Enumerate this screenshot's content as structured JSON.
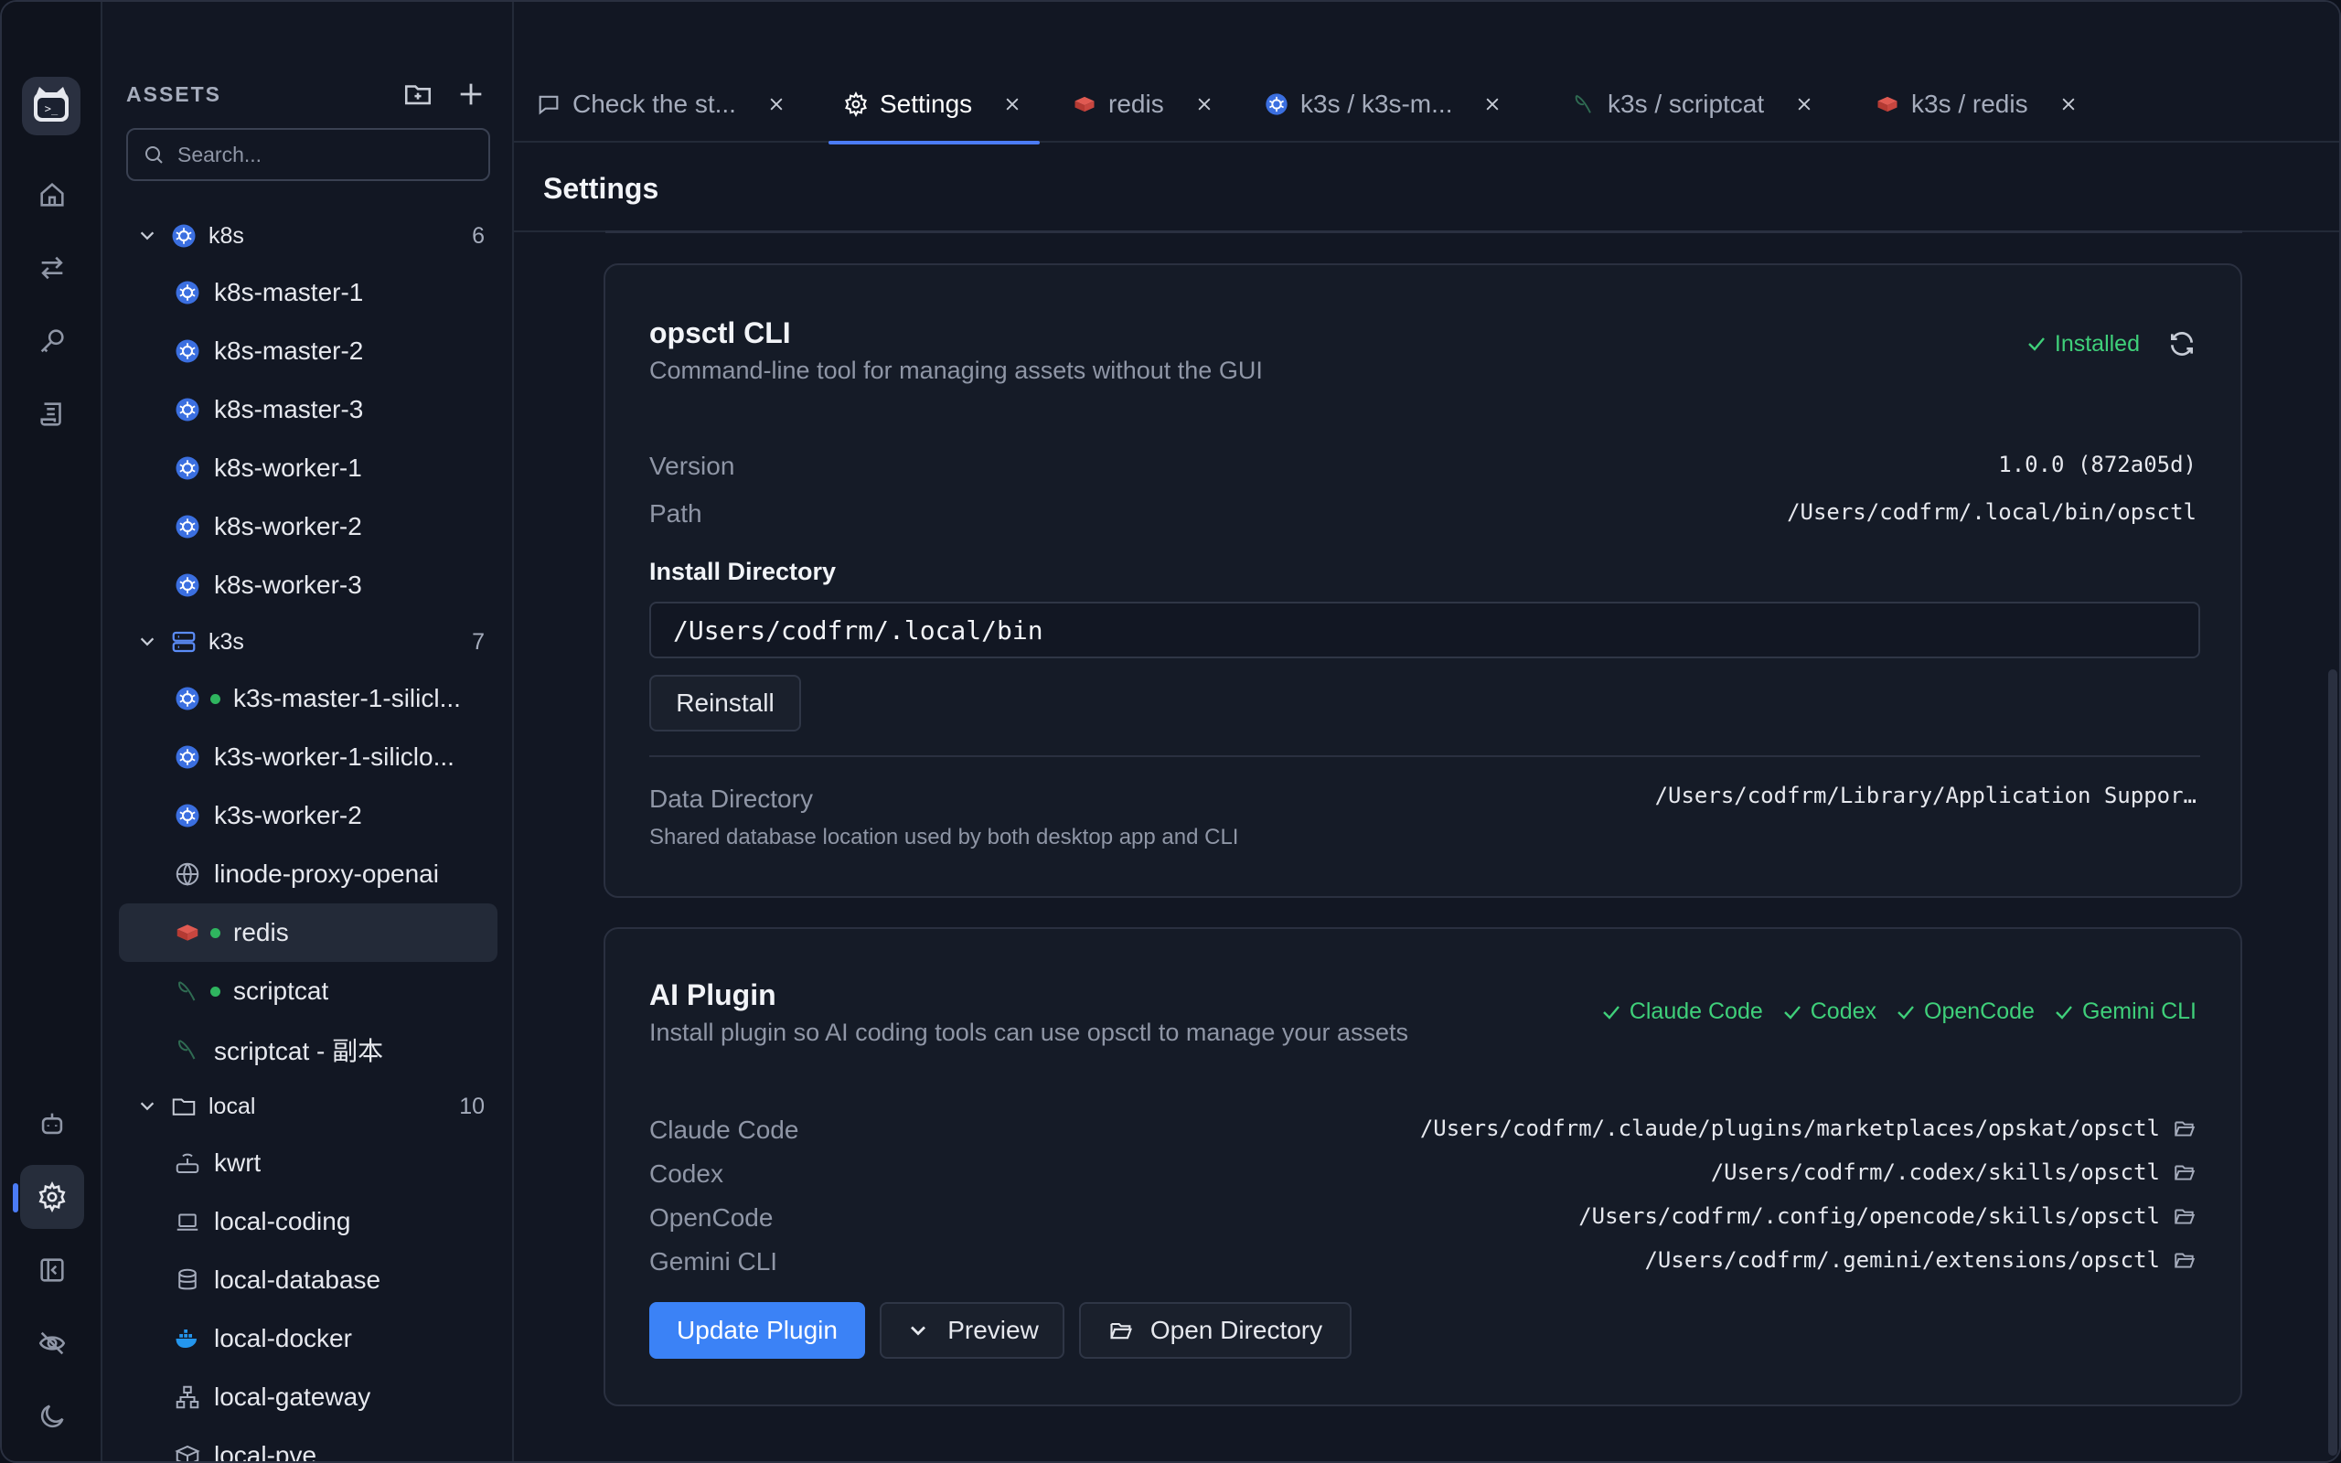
{
  "sidebar": {
    "header": "ASSETS",
    "search_placeholder": "Search...",
    "groups": [
      {
        "name": "k8s",
        "count": "6",
        "items": [
          "k8s-master-1",
          "k8s-master-2",
          "k8s-master-3",
          "k8s-worker-1",
          "k8s-worker-2",
          "k8s-worker-3"
        ]
      },
      {
        "name": "k3s",
        "count": "7",
        "items": [
          "k3s-master-1-silicl...",
          "k3s-worker-1-siliclo...",
          "k3s-worker-2",
          "linode-proxy-openai",
          "redis",
          "scriptcat",
          "scriptcat - 副本"
        ]
      },
      {
        "name": "local",
        "count": "10",
        "items": [
          "kwrt",
          "local-coding",
          "local-database",
          "local-docker",
          "local-gateway",
          "local-pve"
        ]
      }
    ]
  },
  "tabs": [
    {
      "label": "Check the st...",
      "icon": "chat-icon"
    },
    {
      "label": "Settings",
      "icon": "gear-icon",
      "active": true
    },
    {
      "label": "redis",
      "icon": "redis-icon"
    },
    {
      "label": "k3s / k3s-m...",
      "icon": "kubernetes-icon"
    },
    {
      "label": "k3s / scriptcat",
      "icon": "leaf-icon"
    },
    {
      "label": "k3s / redis",
      "icon": "redis-icon"
    }
  ],
  "page_title": "Settings",
  "cli": {
    "title": "opsctl CLI",
    "description": "Command-line tool for managing assets without the GUI",
    "status": "Installed",
    "version_label": "Version",
    "version_value": "1.0.0 (872a05d)",
    "path_label": "Path",
    "path_value": "/Users/codfrm/.local/bin/opsctl",
    "install_dir_label": "Install Directory",
    "install_dir_value": "/Users/codfrm/.local/bin",
    "reinstall_label": "Reinstall",
    "data_dir_label": "Data Directory",
    "data_dir_value": "/Users/codfrm/Library/Application Suppor…",
    "data_dir_note": "Shared database location used by both desktop app and CLI"
  },
  "plugin": {
    "title": "AI Plugin",
    "description": "Install plugin so AI coding tools can use opsctl to manage your assets",
    "statuses": [
      "Claude Code",
      "Codex",
      "OpenCode",
      "Gemini CLI"
    ],
    "rows": [
      {
        "label": "Claude Code",
        "path": "/Users/codfrm/.claude/plugins/marketplaces/opskat/opsctl"
      },
      {
        "label": "Codex",
        "path": "/Users/codfrm/.codex/skills/opsctl"
      },
      {
        "label": "OpenCode",
        "path": "/Users/codfrm/.config/opencode/skills/opsctl"
      },
      {
        "label": "Gemini CLI",
        "path": "/Users/codfrm/.gemini/extensions/opsctl"
      }
    ],
    "update_label": "Update Plugin",
    "preview_label": "Preview",
    "open_dir_label": "Open Directory"
  },
  "colors": {
    "accent": "#3b82f6",
    "success": "#3fd07a",
    "online_dot": "#2fb55f"
  }
}
